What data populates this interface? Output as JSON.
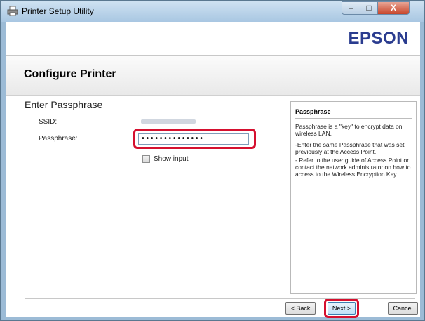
{
  "window": {
    "title": "Printer Setup Utility",
    "close_glyph": "X",
    "min_glyph": "–",
    "max_glyph": "□"
  },
  "header": {
    "logo": "EPSON"
  },
  "page": {
    "heading": "Configure Printer",
    "section_title": "Enter Passphrase"
  },
  "form": {
    "ssid_label": "SSID:",
    "passphrase_label": "Passphrase:",
    "passphrase_value": "••••••••••••••",
    "show_input_label": "Show input",
    "show_input_checked": false
  },
  "help": {
    "title": "Passphrase",
    "paragraph1": "Passphrase is a \"key\" to encrypt data on wireless LAN.",
    "paragraph2": "-Enter the same Passphrase that was set previously at the Access Point.",
    "paragraph3": "- Refer to the user guide of Access Point or contact the network administrator on how to access to the Wireless Encryption Key."
  },
  "buttons": {
    "back": "< Back",
    "next": "Next >",
    "cancel": "Cancel"
  },
  "colors": {
    "highlight": "#d5102f",
    "logo": "#2a3c8f"
  },
  "icons": {
    "app": "printer-icon"
  }
}
